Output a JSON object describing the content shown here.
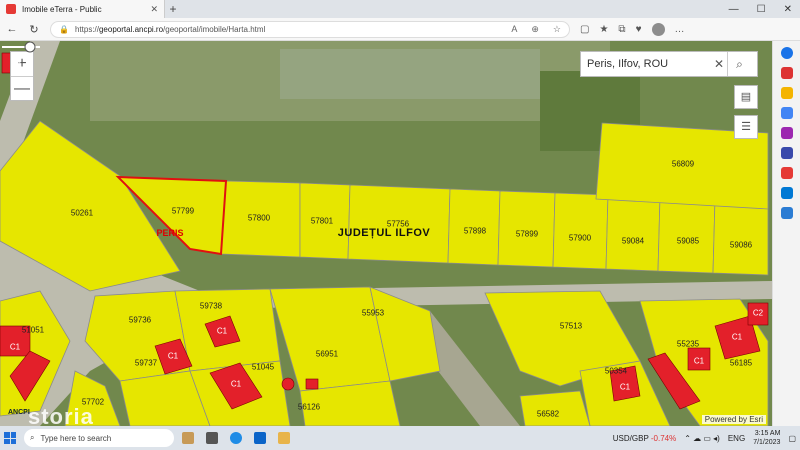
{
  "browser": {
    "tab_title": "Imobile eTerra - Public",
    "url_host": "geoportal.ancpi.ro",
    "url_rest": "/geoportal/imobile/Harta.html",
    "url_scheme": "https://"
  },
  "map": {
    "search_value": "Peris, Ilfov, ROU",
    "county_label": "JUDEȚUL ILFOV",
    "locality_label": "PERIS",
    "powered_by": "Powered by Esri",
    "logo_text": "ANCPI",
    "watermark": "storia",
    "parcels": [
      "50261",
      "57799",
      "57800",
      "57801",
      "57756",
      "57898",
      "57899",
      "57900",
      "59084",
      "59085",
      "59086",
      "56809",
      "59736",
      "59738",
      "59737",
      "51045",
      "56951",
      "55953",
      "56126",
      "51051",
      "57702",
      "57513",
      "55235",
      "56185",
      "50354",
      "56582"
    ],
    "building_label": "C1",
    "building_label_2": "C2"
  },
  "taskbar": {
    "search_placeholder": "Type here to search",
    "stock_name": "USD/GBP",
    "stock_change": "-0.74%",
    "lang": "ENG",
    "time": "3:15 AM",
    "date": "7/1/2023"
  },
  "colors": {
    "parcel_fill": "#e6e600",
    "building": "#e3202a",
    "outline_red": "#e01010"
  }
}
